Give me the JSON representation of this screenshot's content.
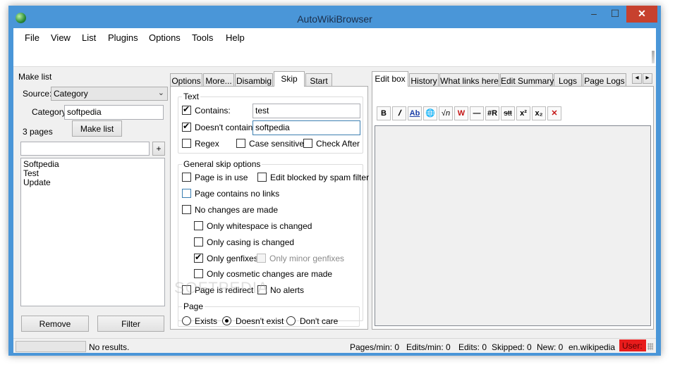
{
  "window": {
    "title": "AutoWikiBrowser",
    "minimize": "–",
    "maximize": "☐",
    "close": "✕"
  },
  "menu": [
    "File",
    "View",
    "List",
    "Plugins",
    "Options",
    "Tools",
    "Help"
  ],
  "make_list": {
    "heading": "Make list",
    "source_label": "Source:",
    "source_value": "Category",
    "category_label": "Category:",
    "category_value": "softpedia",
    "count": "3 pages",
    "make_button": "Make list",
    "add_button": "+",
    "items": [
      "Softpedia",
      "Test",
      "Update"
    ],
    "remove_button": "Remove",
    "filter_button": "Filter"
  },
  "tabs": [
    "Options",
    "More...",
    "Disambig",
    "Skip",
    "Start"
  ],
  "active_tab": "Skip",
  "skip": {
    "text_group": "Text",
    "contains_label": "Contains:",
    "contains_value": "test",
    "not_contains_label": "Doesn't contain:",
    "not_contains_value": "softpedia",
    "regex": "Regex",
    "case_sensitive": "Case sensitive",
    "check_after": "Check After",
    "general_group": "General skip options",
    "page_in_use": "Page is in use",
    "edit_blocked": "Edit blocked by spam filter",
    "no_links": "Page contains no links",
    "no_changes": "No changes are made",
    "only_whitespace": "Only whitespace is changed",
    "only_casing": "Only casing is changed",
    "only_genfixes": "Only genfixes",
    "only_minor_genfixes": "Only minor genfixes",
    "only_cosmetic": "Only cosmetic changes are made",
    "page_redirect": "Page is redirect",
    "no_alerts": "No alerts",
    "page_group": "Page",
    "exists": "Exists",
    "doesnt_exist": "Doesn't exist",
    "dont_care": "Don't care"
  },
  "right_tabs": [
    "Edit box",
    "History",
    "What links here",
    "Edit Summary",
    "Logs",
    "Page Logs"
  ],
  "right_active_tab": "Edit box",
  "scroll_left": "◂",
  "scroll_right": "▸",
  "editor_icons": [
    "B",
    "𝐼",
    "Ab",
    "🌐",
    "√n",
    "W",
    "—",
    "#R",
    "stt",
    "x²",
    "x₂",
    "✕"
  ],
  "status": {
    "message": "No results.",
    "pages_min": "Pages/min: 0",
    "edits_min": "Edits/min: 0",
    "edits": "Edits: 0",
    "skipped": "Skipped: 0",
    "new": "New: 0",
    "site": "en.wikipedia",
    "user": "User:"
  },
  "watermark": "SOFTPEDIA",
  "colors": {
    "user_badge": "#e81c1c",
    "titlebar": "#4a96d8",
    "close_button": "#c7412e"
  }
}
